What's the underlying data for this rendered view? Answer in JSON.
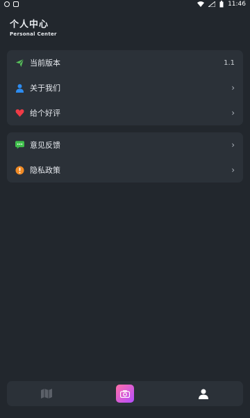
{
  "status_bar": {
    "time": "11:46"
  },
  "header": {
    "title": "个人中心",
    "subtitle": "Personal Center"
  },
  "menu_group_1": [
    {
      "label": "当前版本",
      "value": "1.1",
      "icon": "paper-plane-icon",
      "color": "#58c35b"
    },
    {
      "label": "关于我们",
      "value": "",
      "icon": "person-icon",
      "color": "#2d8cf0"
    },
    {
      "label": "给个好评",
      "value": "",
      "icon": "heart-icon",
      "color": "#ef3b46"
    }
  ],
  "menu_group_2": [
    {
      "label": "意见反馈",
      "value": "",
      "icon": "message-icon",
      "color": "#3fbf4b"
    },
    {
      "label": "隐私政策",
      "value": "",
      "icon": "warning-icon",
      "color": "#f08a24"
    }
  ],
  "chevron": "›",
  "bottom_nav": [
    {
      "icon": "map-icon"
    },
    {
      "icon": "camera-icon"
    },
    {
      "icon": "profile-icon"
    }
  ]
}
